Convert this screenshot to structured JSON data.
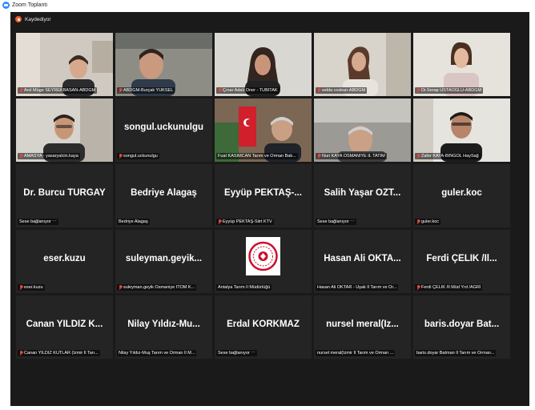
{
  "window": {
    "title": "Zoom Toplantı"
  },
  "recording": {
    "label": "Kaydediyor"
  },
  "colors": {
    "accent": "#2d8cff",
    "recording": "#e8612c",
    "muted_mic": "#e24a3b",
    "active_speaker": "#c8e64a",
    "tile_bg": "#242424"
  },
  "tiles": [
    {
      "label": "Anıl Müge SEYREKBASAN-ABDGM",
      "muted": true
    },
    {
      "label": "ABDGM-Burçak YÜKSEL",
      "muted": true
    },
    {
      "label": "Çınar Adalı Öner - TÜBİTAK",
      "muted": true
    },
    {
      "label": "selda coskun-ABDGM",
      "muted": true
    },
    {
      "label": "Dr.Serap USTAOĞLU-ABDGM",
      "muted": true
    },
    {
      "label": "AMASYA - yasaryalcin.kaya",
      "muted": true
    },
    {
      "display_name": "songul.uckunulgu",
      "label": "songul.uckunulgu",
      "muted": true
    },
    {
      "label": "Fuat KASIMCAN Tarım ve Orman Bak...",
      "muted": false
    },
    {
      "label": "Nuri KAYA OSMANİYE İL TATIM",
      "muted": true
    },
    {
      "label": "Zafer KAYA-BİNGÖL HaySağ",
      "muted": true
    },
    {
      "display_name": "Dr. Burcu TURGAY",
      "label": "Sese bağlanıyor ⋯",
      "muted": false
    },
    {
      "display_name": "Bedriye Alagaş",
      "label": "Bedriye Alagaş",
      "muted": false
    },
    {
      "display_name": "Eyyüp PEKTAŞ-...",
      "label": "Eyyüp PEKTAŞ-Siirt KTV",
      "muted": true
    },
    {
      "display_name": "Salih Yaşar ÖZT...",
      "label": "Sese bağlanıyor ⋯",
      "muted": false
    },
    {
      "display_name": "guler.koc",
      "label": "guler.koc",
      "muted": true
    },
    {
      "display_name": "eser.kuzu",
      "label": "eser.kuzu",
      "muted": true
    },
    {
      "display_name": "suleyman.geyik...",
      "label": "suleyman.geyik Osmaniye İTOM K...",
      "muted": true
    },
    {
      "label": "Antalya Tarım İl Müdürlüğü",
      "muted": false
    },
    {
      "display_name": "Hasan Ali OKTA...",
      "label": "Hasan Ali OKTAR - Uşak İl Tarım ve Or...",
      "muted": false
    },
    {
      "display_name": "Ferdi ÇELİK /İl...",
      "label": "Ferdi ÇELİK /İl Müd Yrd /AĞRI",
      "muted": true
    },
    {
      "display_name": "Canan YILDIZ K...",
      "label": "Canan YILDIZ KUTLAR (İzmir İl Tarı...",
      "muted": true
    },
    {
      "display_name": "Nilay Yıldız-Mu...",
      "label": "Nilay Yıldız-Muş Tarım ve Orman İl M...",
      "muted": false
    },
    {
      "display_name": "Erdal KORKMAZ",
      "label": "Sese bağlanıyor ⋯",
      "muted": false
    },
    {
      "display_name": "nursel meral(İz...",
      "label": "nursel meral(İzmir İl Tarım ve Orman ...",
      "muted": false
    },
    {
      "display_name": "baris.doyar Bat...",
      "label": "baris.doyar Batman İl Tarım ve Orman...",
      "muted": false
    }
  ]
}
